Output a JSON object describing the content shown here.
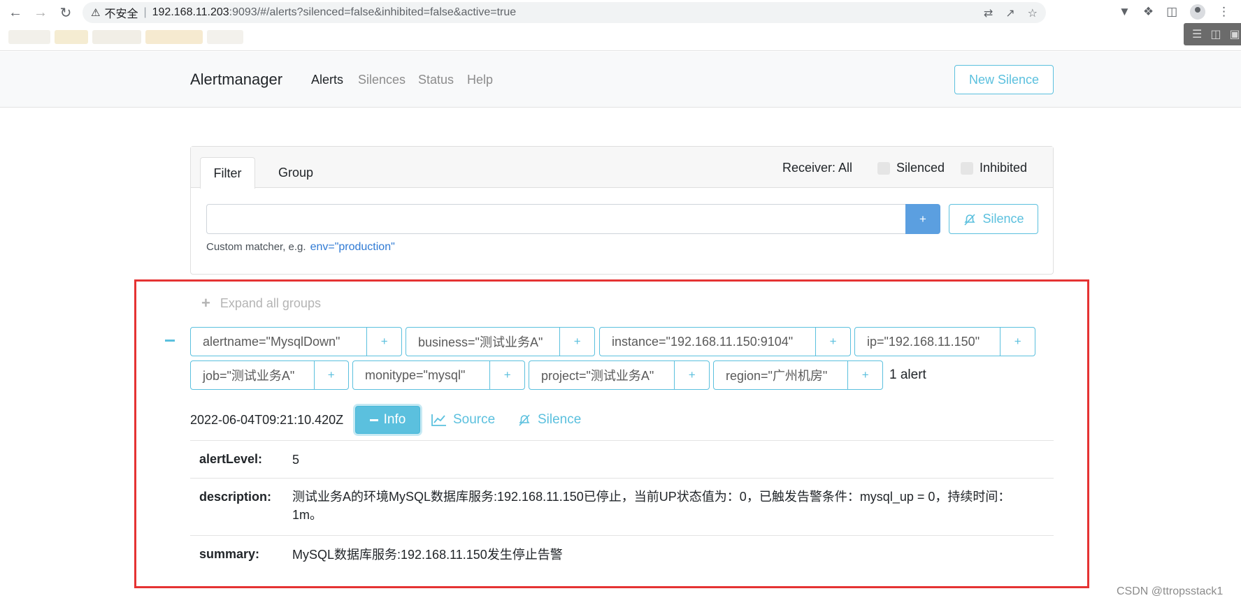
{
  "browser": {
    "insecure_label": "不安全",
    "url_host": "192.168.11.203",
    "url_rest": ":9093/#/alerts?silenced=false&inhibited=false&active=true"
  },
  "navbar": {
    "brand": "Alertmanager",
    "links": [
      "Alerts",
      "Silences",
      "Status",
      "Help"
    ],
    "active_link": "Alerts",
    "new_silence": "New Silence"
  },
  "filter_card": {
    "tabs": [
      "Filter",
      "Group"
    ],
    "receiver": "Receiver: All",
    "silenced_label": "Silenced",
    "inhibited_label": "Inhibited",
    "filter_value": "",
    "add_button": "+",
    "silence_button": "Silence",
    "hint_text": "Custom matcher, e.g.",
    "hint_example": "env=\"production\""
  },
  "group": {
    "expand_all": "Expand all groups",
    "labels": [
      "alertname=\"MysqlDown\"",
      "business=\"测试业务A\"",
      "instance=\"192.168.11.150:9104\"",
      "ip=\"192.168.11.150\"",
      "job=\"测试业务A\"",
      "monitype=\"mysql\"",
      "project=\"测试业务A\"",
      "region=\"广州机房\""
    ],
    "label_add": "+",
    "alert_count": "1 alert"
  },
  "alert": {
    "timestamp": "2022-06-04T09:21:10.420Z",
    "info_button": "Info",
    "source_button": "Source",
    "silence_button": "Silence",
    "annotations": [
      {
        "key": "alertLevel:",
        "value": "5"
      },
      {
        "key": "description:",
        "value": "测试业务A的环境MySQL数据库服务:192.168.11.150已停止，当前UP状态值为：0，已触发告警条件：mysql_up = 0，持续时间：1m。"
      },
      {
        "key": "summary:",
        "value": "MySQL数据库服务:192.168.11.150发生停止告警"
      }
    ]
  },
  "watermark": "CSDN @ttropsstack1",
  "colors": {
    "info": "#5bc0de",
    "primary": "#5b9fe0",
    "highlight": "#e53333"
  }
}
